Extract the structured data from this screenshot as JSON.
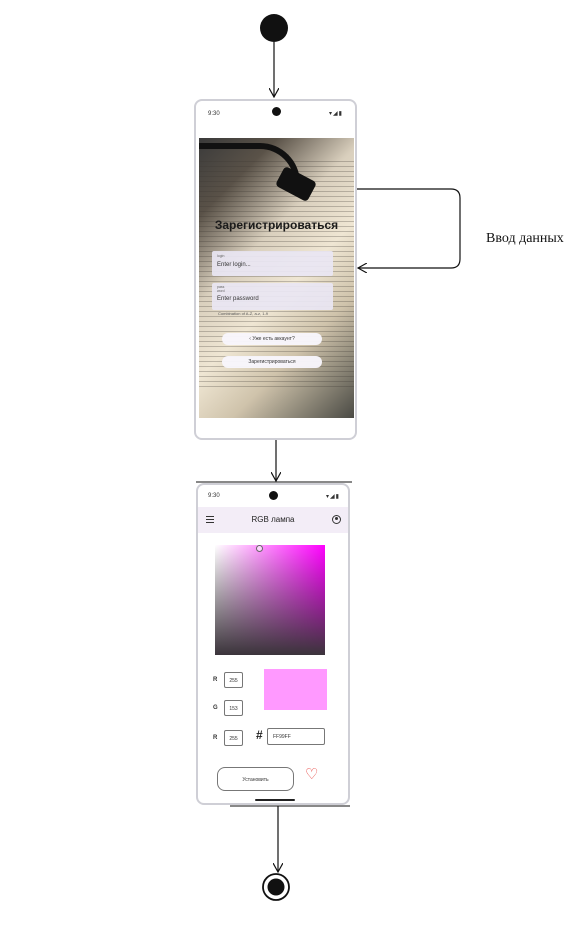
{
  "diagram": {
    "loop_label": "Ввод данных",
    "colors": {
      "line": "#111111",
      "accent": "#ff99ff",
      "heart": "#e53935"
    }
  },
  "screen_register": {
    "status_time": "9:30",
    "status_icons": "▾◢▮",
    "title": "Зарегистрироваться",
    "login_label": "login",
    "login_placeholder": "Enter login...",
    "password_label_1": "pass",
    "password_label_2": "word",
    "password_placeholder": "Enter password",
    "password_hint": "Combination of A-Z, a-z, 1-9",
    "have_account_label": "Уже есть аккаунт?",
    "back_icon": "chevron-left-icon",
    "submit_label": "Зарегистрироваться"
  },
  "screen_rgb": {
    "status_time": "9:30",
    "status_icons": "▾◢▮",
    "title": "RGB лампа",
    "menu_icon": "menu-icon",
    "profile_icon": "account-icon",
    "channels": [
      {
        "label": "R",
        "value": "255"
      },
      {
        "label": "G",
        "value": "153"
      },
      {
        "label": "R",
        "value": "255"
      }
    ],
    "hash_symbol": "#",
    "hex_value": "FF99FF",
    "preview_color": "#ff99ff",
    "set_button_label": "Установить",
    "heart_symbol": "♡"
  }
}
